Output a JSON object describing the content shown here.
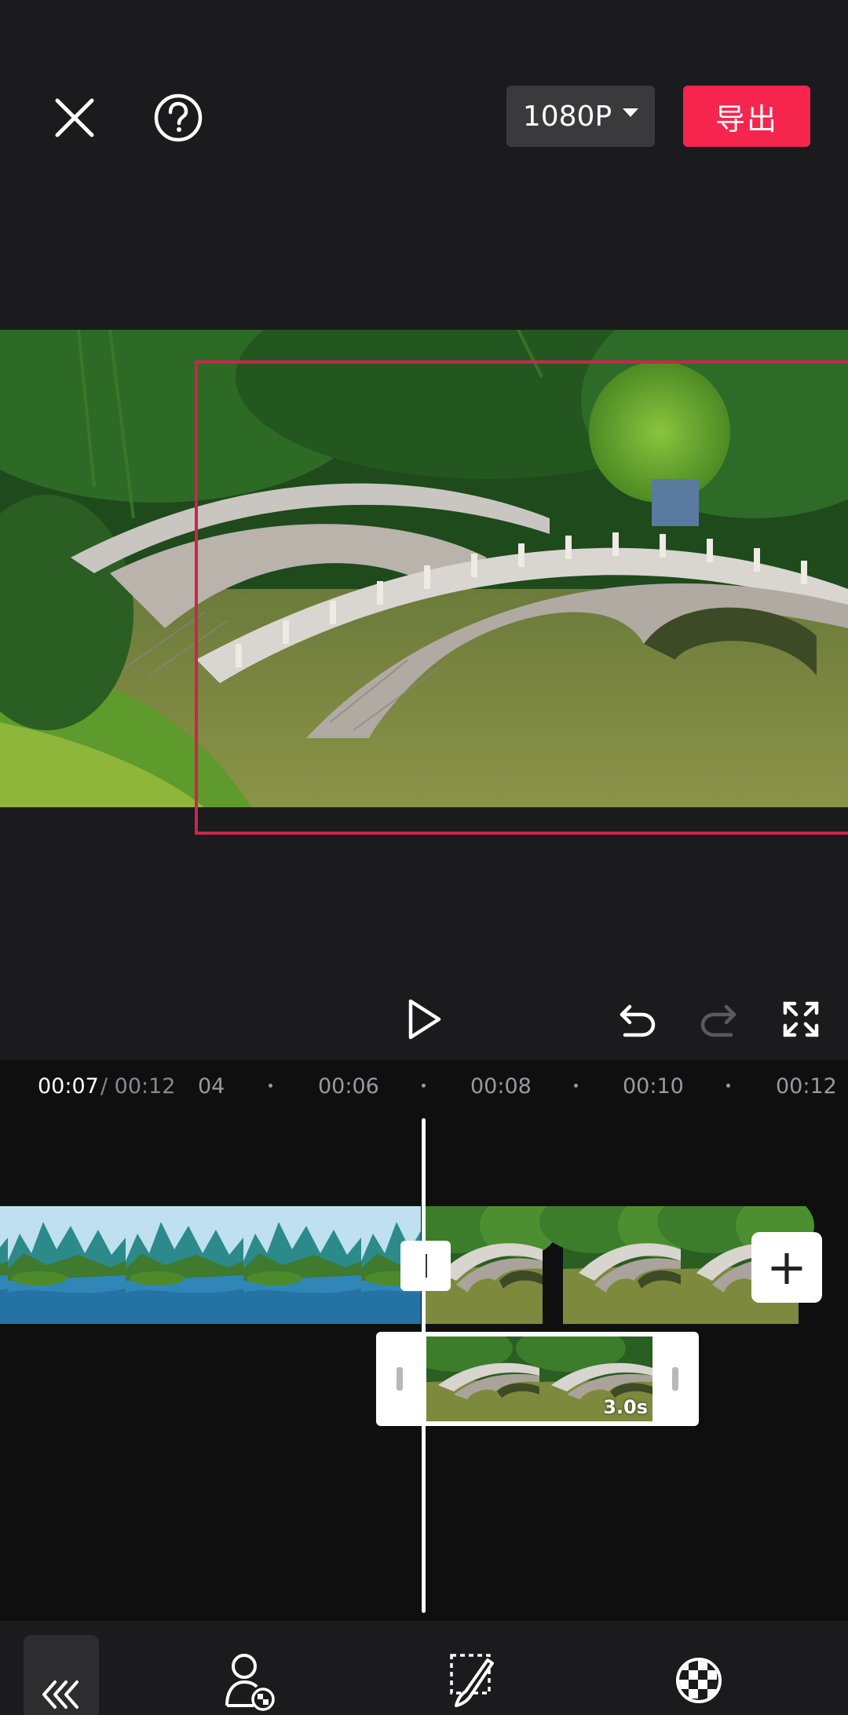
{
  "header": {
    "resolution_label": "1080P",
    "export_label": "导出"
  },
  "timeline": {
    "current_time": "00:07",
    "total_time": "/ 00:12",
    "ruler_labels": [
      "04",
      "00:06",
      "00:08",
      "00:10",
      "00:12"
    ],
    "overlay_clip_duration": "3.0s",
    "add_clip_symbol": "+"
  },
  "icons": {
    "close": "close-icon",
    "help": "help-icon",
    "resolution_caret": "caret-down-icon",
    "play": "play-icon",
    "undo": "undo-icon",
    "redo": "redo-icon",
    "fullscreen": "fullscreen-icon",
    "back": "double-chevron-left-icon",
    "cutout": "cutout-person-icon",
    "mask_brush": "mask-brush-icon",
    "chroma": "chroma-key-icon"
  },
  "colors": {
    "accent": "#f5254e",
    "selection_frame": "#c7274b",
    "redo_disabled": "#5a5a5e"
  }
}
